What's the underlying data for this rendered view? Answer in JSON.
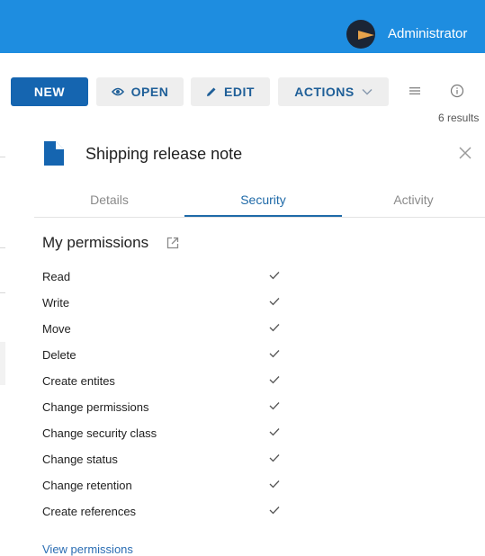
{
  "header": {
    "user_name": "Administrator",
    "bar_color": "#1e8de0"
  },
  "toolbar": {
    "new_label": "NEW",
    "open_label": "OPEN",
    "edit_label": "EDIT",
    "actions_label": "ACTIONS",
    "results_text": "6 results",
    "icons": [
      "eye-icon",
      "pencil-icon",
      "chevron-down-icon",
      "list-view-icon",
      "info-icon"
    ]
  },
  "panel": {
    "title": "Shipping release note",
    "tabs": [
      {
        "label": "Details",
        "active": false
      },
      {
        "label": "Security",
        "active": true
      },
      {
        "label": "Activity",
        "active": false
      }
    ],
    "section_title": "My permissions",
    "permissions": [
      {
        "label": "Read",
        "granted": true
      },
      {
        "label": "Write",
        "granted": true
      },
      {
        "label": "Move",
        "granted": true
      },
      {
        "label": "Delete",
        "granted": true
      },
      {
        "label": "Create entites",
        "granted": true
      },
      {
        "label": "Change permissions",
        "granted": true
      },
      {
        "label": "Change security class",
        "granted": true
      },
      {
        "label": "Change status",
        "granted": true
      },
      {
        "label": "Change retention",
        "granted": true
      },
      {
        "label": "Create references",
        "granted": true
      }
    ],
    "view_permissions_link": "View permissions",
    "accent_color": "#1f6aa8"
  }
}
